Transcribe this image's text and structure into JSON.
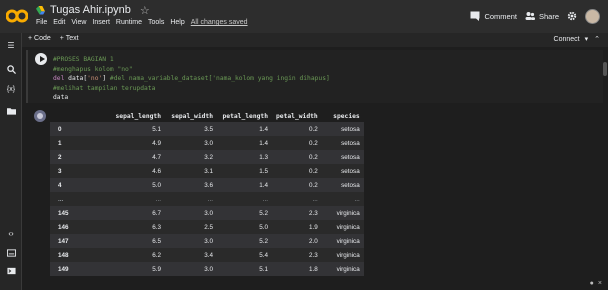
{
  "app": {
    "logo": "CO",
    "doc_title": "Tugas Ahir.ipynb",
    "star_icon": "star-icon"
  },
  "menu": [
    "File",
    "Edit",
    "View",
    "Insert",
    "Runtime",
    "Tools",
    "Help"
  ],
  "saved_status": "All changes saved",
  "header_actions": {
    "comment": "Comment",
    "share": "Share"
  },
  "toolbar": {
    "add_code": "+ Code",
    "add_text": "+ Text",
    "connect": "Connect"
  },
  "code_lines": [
    [
      [
        "c-comment",
        "#PROSES BAGIAN 1"
      ]
    ],
    [
      [
        "c-comment",
        "#menghapus kolom \"no\""
      ]
    ],
    [
      [
        "c-kw",
        "del "
      ],
      [
        "c-id",
        "data["
      ],
      [
        "c-str",
        "'no'"
      ],
      [
        "c-id",
        "] "
      ],
      [
        "c-comment",
        "#del nama_variable_dataset['nama_kolom yang ingin dihapus]"
      ]
    ],
    [
      [
        "c-comment",
        "#melihat tampilan terupdata"
      ]
    ],
    [
      [
        "c-id",
        "data"
      ]
    ]
  ],
  "table": {
    "columns": [
      "",
      "sepal_length",
      "sepal_width",
      "petal_length",
      "petal_width",
      "species"
    ],
    "rows": [
      [
        "0",
        "5.1",
        "3.5",
        "1.4",
        "0.2",
        "setosa"
      ],
      [
        "1",
        "4.9",
        "3.0",
        "1.4",
        "0.2",
        "setosa"
      ],
      [
        "2",
        "4.7",
        "3.2",
        "1.3",
        "0.2",
        "setosa"
      ],
      [
        "3",
        "4.6",
        "3.1",
        "1.5",
        "0.2",
        "setosa"
      ],
      [
        "4",
        "5.0",
        "3.6",
        "1.4",
        "0.2",
        "setosa"
      ],
      [
        "...",
        "...",
        "...",
        "...",
        "...",
        "..."
      ],
      [
        "145",
        "6.7",
        "3.0",
        "5.2",
        "2.3",
        "virginica"
      ],
      [
        "146",
        "6.3",
        "2.5",
        "5.0",
        "1.9",
        "virginica"
      ],
      [
        "147",
        "6.5",
        "3.0",
        "5.2",
        "2.0",
        "virginica"
      ],
      [
        "148",
        "6.2",
        "3.4",
        "5.4",
        "2.3",
        "virginica"
      ],
      [
        "149",
        "5.9",
        "3.0",
        "5.1",
        "1.8",
        "virginica"
      ]
    ]
  },
  "colors": {
    "logo_orange": "#f9ab00",
    "background": "#1e1e1e",
    "header": "#2d2d2d"
  }
}
